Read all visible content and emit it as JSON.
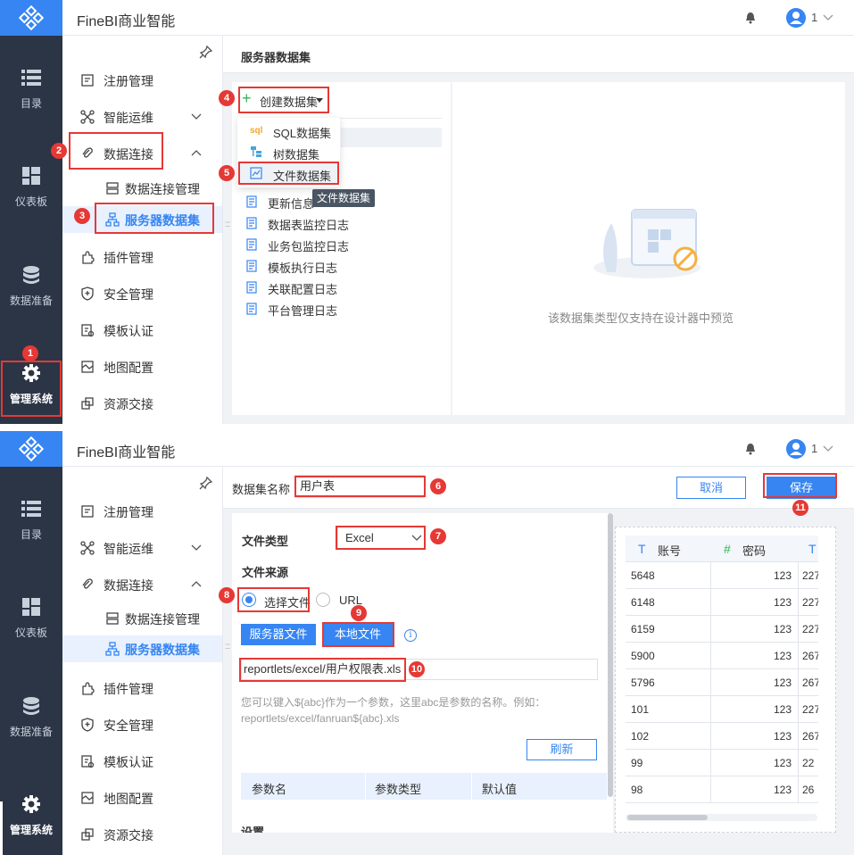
{
  "app": {
    "title": "FineBI商业智能",
    "user_count": "1"
  },
  "dark_nav": [
    {
      "label": "目录",
      "icon": "list-icon"
    },
    {
      "label": "仪表板",
      "icon": "dashboard-icon"
    },
    {
      "label": "数据准备",
      "icon": "database-icon"
    },
    {
      "label": "管理系统",
      "icon": "gear-icon"
    }
  ],
  "sidebar": {
    "items": [
      {
        "label": "注册管理",
        "icon": "register-icon"
      },
      {
        "label": "智能运维",
        "icon": "ops-icon"
      },
      {
        "label": "数据连接",
        "icon": "link-icon"
      },
      {
        "label": "数据连接管理",
        "icon": "connection-manage-icon"
      },
      {
        "label": "服务器数据集",
        "icon": "server-dataset-icon"
      },
      {
        "label": "插件管理",
        "icon": "plugin-icon"
      },
      {
        "label": "安全管理",
        "icon": "shield-icon"
      },
      {
        "label": "模板认证",
        "icon": "template-icon"
      },
      {
        "label": "地图配置",
        "icon": "map-icon"
      },
      {
        "label": "资源交接",
        "icon": "handover-icon"
      }
    ]
  },
  "panel1": {
    "content_title": "服务器数据集",
    "create_button": "创建数据集",
    "dropdown": [
      {
        "label": "SQL数据集",
        "icon": "sql-icon",
        "icon_text": "sql"
      },
      {
        "label": "树数据集",
        "icon": "tree-icon"
      },
      {
        "label": "文件数据集",
        "icon": "file-chart-icon"
      }
    ],
    "tooltip": "文件数据集",
    "logs": [
      "更新信息",
      "数据表监控日志",
      "业务包监控日志",
      "模板执行日志",
      "关联配置日志",
      "平台管理日志"
    ],
    "empty_text": "该数据集类型仅支持在设计器中预览"
  },
  "panel2": {
    "name_label": "数据集名称",
    "name_value": "用户表",
    "cancel": "取消",
    "save": "保存",
    "file_type_label": "文件类型",
    "file_type_value": "Excel",
    "file_source_label": "文件来源",
    "radio_select": "选择文件",
    "radio_url": "URL",
    "server_file": "服务器文件",
    "local_file": "本地文件",
    "path_value": "reportlets/excel/用户权限表.xls",
    "hint": "您可以键入${abc}作为一个参数，这里abc是参数的名称。例如：reportlets/excel/fanruan${abc}.xls",
    "refresh": "刷新",
    "param_headers": [
      "参数名",
      "参数类型",
      "默认值"
    ],
    "settings_label": "设置",
    "preview": {
      "columns": [
        {
          "name": "账号",
          "type_icon": "T"
        },
        {
          "name": "密码",
          "type_icon": "#"
        },
        {
          "name": "",
          "type_icon": "T"
        }
      ],
      "rows": [
        [
          "5648",
          "123",
          "227"
        ],
        [
          "6148",
          "123",
          "227"
        ],
        [
          "6159",
          "123",
          "227"
        ],
        [
          "5900",
          "123",
          "267"
        ],
        [
          "5796",
          "123",
          "267"
        ],
        [
          "101",
          "123",
          "227"
        ],
        [
          "102",
          "123",
          "267"
        ],
        [
          "99",
          "123",
          "22"
        ],
        [
          "98",
          "123",
          "26"
        ]
      ]
    }
  },
  "steps": [
    "1",
    "2",
    "3",
    "4",
    "5",
    "6",
    "7",
    "8",
    "9",
    "10",
    "11"
  ],
  "colors": {
    "accent": "#3685f2",
    "highlight": "#e53935",
    "dark_nav": "#2b3545"
  }
}
